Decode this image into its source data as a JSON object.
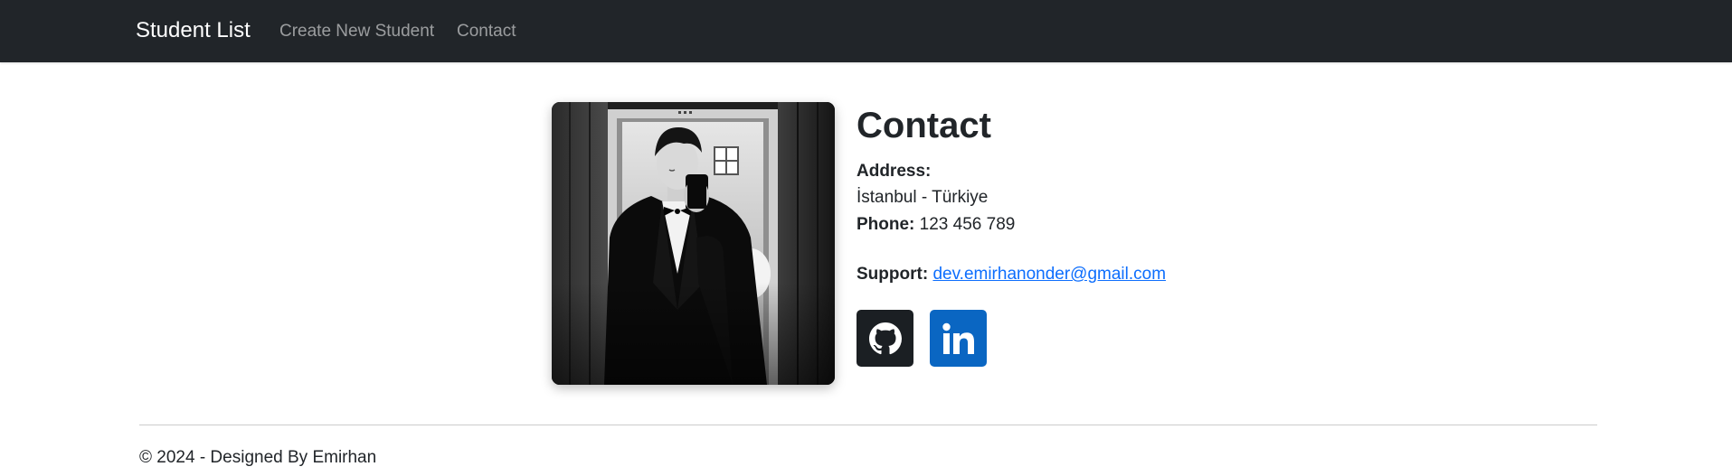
{
  "navbar": {
    "brand": "Student List",
    "links": [
      {
        "label": "Create New Student"
      },
      {
        "label": "Contact"
      }
    ],
    "background_color": "#212529"
  },
  "contact": {
    "heading": "Contact",
    "address_label": "Address:",
    "address_value": "İstanbul - Türkiye",
    "phone_label": "Phone:",
    "phone_value": "123 456 789",
    "support_label": "Support:",
    "support_email": "dev.emirhanonder@gmail.com",
    "link_color": "#0d6efd"
  },
  "social": [
    {
      "icon": "github-icon",
      "color": "#1b1f23"
    },
    {
      "icon": "linkedin-icon",
      "color": "#0a66c2"
    }
  ],
  "footer": {
    "text": "© 2024 - Designed By Emirhan"
  }
}
